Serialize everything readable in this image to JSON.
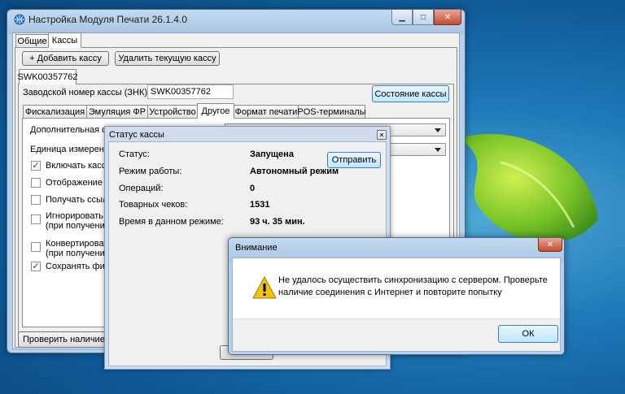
{
  "main_window": {
    "title": "Настройка Модуля Печати 26.1.4.0",
    "top_tabs": [
      "Общие",
      "Кассы"
    ],
    "add_label": "+ Добавить кассу",
    "delete_label": "Удалить текущую кассу",
    "device_tab": "SWK00357762",
    "serial_label": "Заводской номер кассы (ЗНК):",
    "serial_value": "SWK00357762",
    "status_button": "Состояние кассы",
    "sub_tabs": [
      "Фискализация",
      "Эмуляция ФР",
      "Устройство",
      "Другое",
      "Формат печати",
      "POS-терминалы"
    ],
    "additional_label": "Дополнительная обработка",
    "unit_label": "Единица измерения в",
    "opt1": "Включать кассу п",
    "opt2": "Отображение оши",
    "opt3": "Получать ссылки",
    "opt4a": "Игнорировать НДС",
    "opt4b": "(при получении н",
    "opt5a": "Конвертировать Н",
    "opt5b": "(при получении ст",
    "opt6": "Сохранять фискал",
    "check_button": "Проверить наличие обн"
  },
  "status_dialog": {
    "title": "Статус кассы",
    "status_label": "Статус:",
    "status_value": "Запущена",
    "send_button": "Отправить",
    "mode_label": "Режим работы:",
    "mode_value": "Автономный режим",
    "ops_label": "Операций:",
    "ops_value": "0",
    "checks_label": "Товарных чеков:",
    "checks_value": "1531",
    "time_label": "Время в данном режиме:",
    "time_value": "93 ч. 35 мин.",
    "ok_partial": "ОК"
  },
  "alert_dialog": {
    "title": "Внимание",
    "message_line1": "Не удалось осуществить синхронизацию с сервером. Проверьте",
    "message_line2": "наличие соединения с Интернет и повторите попытку",
    "ok_label": "ОК"
  },
  "colors": {
    "accent": "#3c7fb1",
    "warning": "#f2c20c"
  }
}
